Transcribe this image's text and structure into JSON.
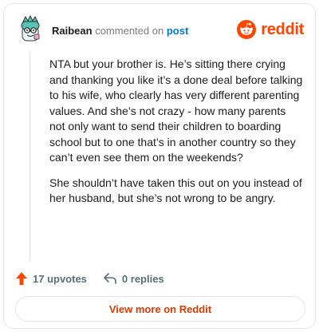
{
  "comment": {
    "username": "Raibean",
    "verb": "commented on",
    "post_link": "post",
    "paragraphs": [
      "NTA but your brother is. He’s sitting there crying and thanking you like it’s a done deal before talking to his wife, who clearly has very different parenting values. And she’s not crazy - how many parents not only want to send their children to boarding school but to one that’s in another country so they can’t even see them on the weekends?",
      "She shouldn’t have taken this out on you instead of her husband, but she’s not wrong to be angry."
    ]
  },
  "brand": {
    "name": "reddit"
  },
  "actions": {
    "upvotes_label": "17 upvotes",
    "replies_label": "0 replies"
  },
  "footer": {
    "view_more_label": "View more on Reddit"
  },
  "colors": {
    "accent": "#ff4500",
    "link": "#0079d3",
    "view_more": "#d93a00"
  },
  "icons": {
    "upvote": "upvote-arrow-icon",
    "reply": "reply-arrow-icon",
    "logo": "reddit-snoo-icon",
    "avatar": "snoo-avatar-icon"
  }
}
